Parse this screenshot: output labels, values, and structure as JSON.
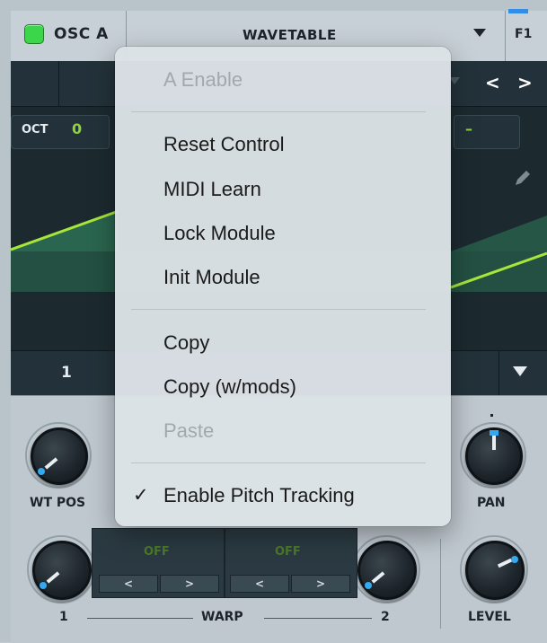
{
  "oscillator": {
    "name": "OSC A",
    "enabled": true,
    "wavetable_name": "WAVETABLE",
    "filter_label": "F1"
  },
  "display": {
    "oct_label": "OCT",
    "oct_value": "0",
    "right_value": "–",
    "frame_number": "1",
    "nav_prev": "<",
    "nav_next": ">"
  },
  "knobs": {
    "wt_pos_label": "WT POS",
    "pan_label": "PAN",
    "level_label": "LEVEL",
    "warp1_label": "1",
    "warp2_label": "2",
    "warp_label": "WARP"
  },
  "warp_modes": [
    {
      "value": "OFF",
      "prev": "<",
      "next": ">"
    },
    {
      "value": "OFF",
      "prev": "<",
      "next": ">"
    }
  ],
  "context_menu": {
    "items": [
      {
        "label": "A Enable",
        "enabled": false
      },
      {
        "label": "Reset Control",
        "enabled": true
      },
      {
        "label": "MIDI Learn",
        "enabled": true
      },
      {
        "label": "Lock Module",
        "enabled": true
      },
      {
        "label": "Init Module",
        "enabled": true
      },
      {
        "label": "Copy",
        "enabled": true
      },
      {
        "label": "Copy (w/mods)",
        "enabled": true
      },
      {
        "label": "Paste",
        "enabled": false
      },
      {
        "label": "Enable Pitch Tracking",
        "enabled": true,
        "checked": true
      }
    ]
  },
  "colors": {
    "power_led": "#3cd64a",
    "accent_green": "#8fd43a",
    "accent_blue": "#2e8ee8",
    "knob_indicator": "#34a9f0"
  },
  "icons": {
    "check": "checkmark-icon",
    "pencil": "pencil-icon",
    "dropdown": "chevron-down-icon"
  }
}
